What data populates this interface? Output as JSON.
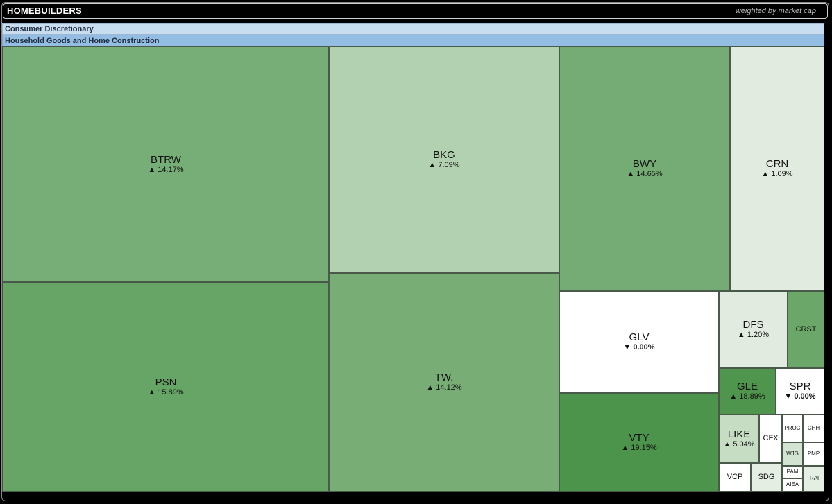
{
  "header": {
    "title": "HOMEBUILDERS",
    "subtitle": "weighted by market cap"
  },
  "sector": "Consumer Discretionary",
  "industry": "Household Goods and Home Construction",
  "chart_data": {
    "type": "treemap",
    "title": "HOMEBUILDERS",
    "subtitle": "weighted by market cap",
    "hierarchy": [
      "Consumer Discretionary",
      "Household Goods and Home Construction"
    ],
    "tiles": [
      {
        "symbol": "BTRW",
        "change": "▲ 14.17%",
        "value": 14.17,
        "color": "#77ad76"
      },
      {
        "symbol": "PSN",
        "change": "▲ 15.89%",
        "value": 15.89,
        "color": "#66a566"
      },
      {
        "symbol": "BKG",
        "change": "▲ 7.09%",
        "value": 7.09,
        "color": "#b2d1b0"
      },
      {
        "symbol": "TW.",
        "change": "▲ 14.12%",
        "value": 14.12,
        "color": "#78ae76"
      },
      {
        "symbol": "BWY",
        "change": "▲ 14.65%",
        "value": 14.65,
        "color": "#75ab74"
      },
      {
        "symbol": "CRN",
        "change": "▲ 1.09%",
        "value": 1.09,
        "color": "#e2ebe0"
      },
      {
        "symbol": "GLV",
        "change": "▼ 0.00%",
        "value": 0.0,
        "color": "#ffffff"
      },
      {
        "symbol": "VTY",
        "change": "▲ 19.15%",
        "value": 19.15,
        "color": "#4c934b"
      },
      {
        "symbol": "DFS",
        "change": "▲ 1.20%",
        "value": 1.2,
        "color": "#e1ebdf"
      },
      {
        "symbol": "CRST",
        "change": "",
        "color": "#6aa768"
      },
      {
        "symbol": "GLE",
        "change": "▲ 18.89%",
        "value": 18.89,
        "color": "#4f954d"
      },
      {
        "symbol": "SPR",
        "change": "▼ 0.00%",
        "value": 0.0,
        "color": "#ffffff"
      },
      {
        "symbol": "LIKE",
        "change": "▲ 5.04%",
        "value": 5.04,
        "color": "#c6dcc3"
      },
      {
        "symbol": "CFX",
        "change": "",
        "color": "#ffffff"
      },
      {
        "symbol": "VCP",
        "change": "",
        "color": "#ffffff"
      },
      {
        "symbol": "SDG",
        "change": "",
        "color": "#e4eee3"
      },
      {
        "symbol": "PROC",
        "change": "",
        "color": "#ffffff"
      },
      {
        "symbol": "CHH",
        "change": "",
        "color": "#ffffff"
      },
      {
        "symbol": "WJG",
        "change": "",
        "color": "#d4e4d2"
      },
      {
        "symbol": "PMP",
        "change": "",
        "color": "#ffffff"
      },
      {
        "symbol": "PAM",
        "change": "",
        "color": "#ffffff"
      },
      {
        "symbol": "TRAF",
        "change": "",
        "color": "#e4eee3"
      },
      {
        "symbol": "AIEA",
        "change": "",
        "color": "#ffffff"
      }
    ]
  }
}
